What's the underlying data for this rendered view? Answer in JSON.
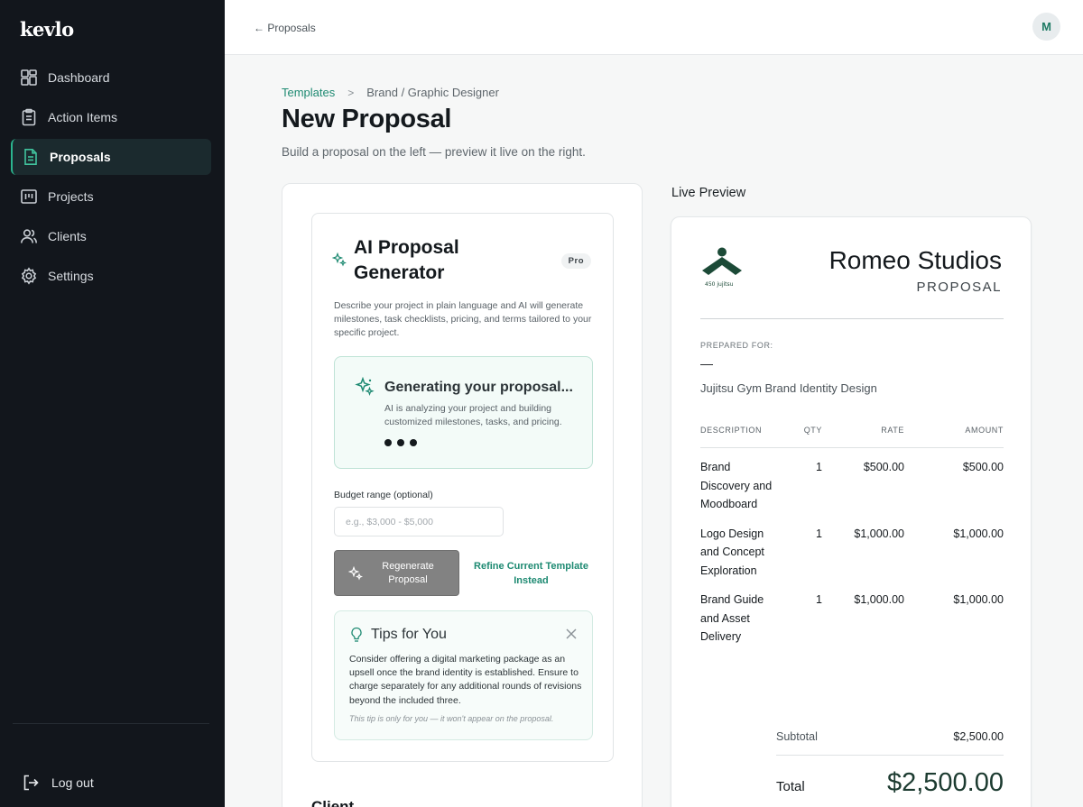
{
  "app": {
    "logo": "kevlo"
  },
  "sidebar": {
    "items": [
      {
        "label": "Dashboard",
        "icon": "dashboard-icon",
        "active": false
      },
      {
        "label": "Action Items",
        "icon": "clipboard-icon",
        "active": false
      },
      {
        "label": "Proposals",
        "icon": "document-icon",
        "active": true
      },
      {
        "label": "Projects",
        "icon": "projects-icon",
        "active": false
      },
      {
        "label": "Clients",
        "icon": "users-icon",
        "active": false
      },
      {
        "label": "Settings",
        "icon": "gear-icon",
        "active": false
      }
    ],
    "logout_label": "Log out"
  },
  "topbar": {
    "back_label": "← Proposals",
    "avatar_initial": "M"
  },
  "page": {
    "breadcrumb": {
      "link": "Templates",
      "separator": ">",
      "current": "Brand / Graphic Designer"
    },
    "title": "New Proposal",
    "subtitle": "Build a proposal on the left — preview it live on the right."
  },
  "ai_generator": {
    "title": "AI Proposal Generator",
    "badge": "Pro",
    "description": "Describe your project in plain language and AI will generate milestones, task checklists, pricing, and terms tailored to your specific project.",
    "generating_title": "Generating your proposal...",
    "generating_desc": "AI is analyzing your project and building customized milestones, tasks, and pricing.",
    "budget_label": "Budget range (optional)",
    "budget_placeholder": "e.g., $3,000 - $5,000",
    "regenerate_label": "Regenerate Proposal",
    "refine_label": "Refine Current Template Instead"
  },
  "tips": {
    "title": "Tips for You",
    "text": "Consider offering a digital marketing package as an upsell once the brand identity is established. Ensure to charge separately for any additional rounds of revisions beyond the included three.",
    "note": "This tip is only for you — it won't appear on the proposal."
  },
  "client_section": {
    "heading": "Client"
  },
  "preview": {
    "label": "Live Preview",
    "logo_text": "450 jujitsu",
    "studio_name": "Romeo Studios",
    "proposal_word": "PROPOSAL",
    "prepared_for_label": "PREPARED FOR:",
    "prepared_for_value": "—",
    "project_title": "Jujitsu Gym Brand Identity Design",
    "columns": {
      "description": "DESCRIPTION",
      "qty": "QTY",
      "rate": "RATE",
      "amount": "AMOUNT"
    },
    "rows": [
      {
        "description": "Brand Discovery and Moodboard",
        "qty": "1",
        "rate": "$500.00",
        "amount": "$500.00"
      },
      {
        "description": "Logo Design and Concept Exploration",
        "qty": "1",
        "rate": "$1,000.00",
        "amount": "$1,000.00"
      },
      {
        "description": "Brand Guide and Asset Delivery",
        "qty": "1",
        "rate": "$1,000.00",
        "amount": "$1,000.00"
      }
    ],
    "subtotal_label": "Subtotal",
    "subtotal_value": "$2,500.00",
    "total_label": "Total",
    "total_value": "$2,500.00"
  },
  "colors": {
    "accent": "#1e8a72",
    "sidebar_bg": "#12161c",
    "active_indicator": "#2bb58f",
    "logo_green": "#1c4a37"
  }
}
